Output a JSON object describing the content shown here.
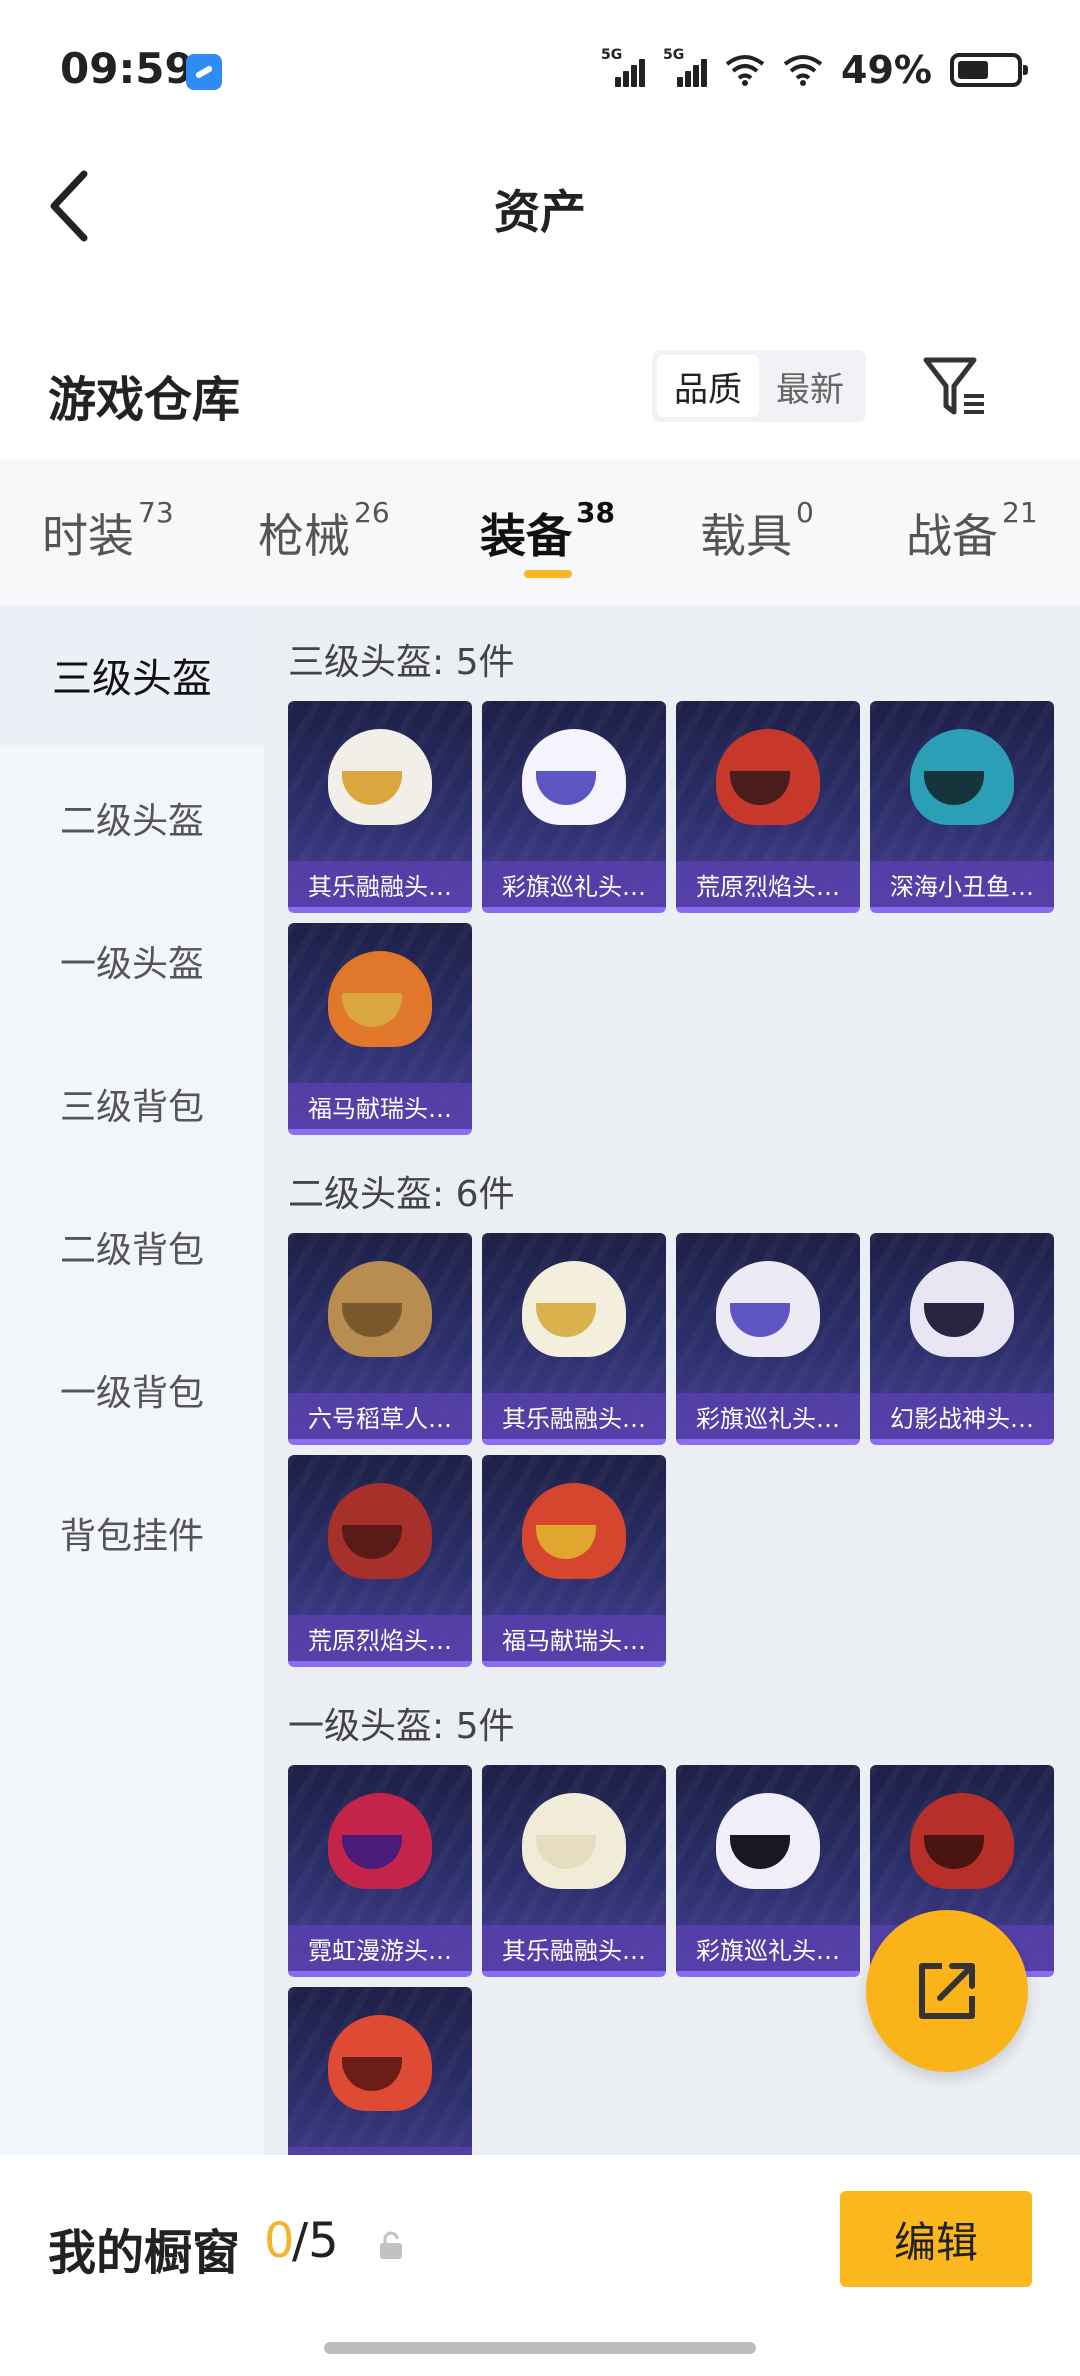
{
  "status_bar": {
    "time": "09:59",
    "signal1_label": "5G",
    "signal2_label": "5G",
    "battery": "49%"
  },
  "nav": {
    "title": "资产"
  },
  "warehouse": {
    "title": "游戏仓库",
    "sort_options": [
      "品质",
      "最新"
    ],
    "active_sort": "品质"
  },
  "tabs": [
    {
      "label": "时装",
      "count": "73"
    },
    {
      "label": "枪械",
      "count": "26"
    },
    {
      "label": "装备",
      "count": "38"
    },
    {
      "label": "载具",
      "count": "0"
    },
    {
      "label": "战备",
      "count": "21"
    }
  ],
  "side_menu": [
    "三级头盔",
    "二级头盔",
    "一级头盔",
    "三级背包",
    "二级背包",
    "一级背包",
    "背包挂件"
  ],
  "sections": [
    {
      "title": "三级头盔: 5件",
      "items": [
        "其乐融融头…",
        "彩旗巡礼头…",
        "荒原烈焰头…",
        "深海小丑鱼…",
        "福马献瑞头…"
      ]
    },
    {
      "title": "二级头盔: 6件",
      "items": [
        "六号稻草人…",
        "其乐融融头…",
        "彩旗巡礼头…",
        "幻影战神头…",
        "荒原烈焰头…",
        "福马献瑞头…"
      ]
    },
    {
      "title": "一级头盔: 5件",
      "items": [
        "霓虹漫游头…",
        "其乐融融头…",
        "彩旗巡礼头…",
        "",
        ""
      ]
    }
  ],
  "showcase": {
    "title": "我的橱窗",
    "current": "0",
    "total": "/5",
    "edit_label": "编辑"
  },
  "colors": {
    "accent": "#fbb71e",
    "card_label_bg": "#5540aa",
    "card_bg_top": "#1e2047",
    "card_bg_bottom": "#4a3f96"
  }
}
